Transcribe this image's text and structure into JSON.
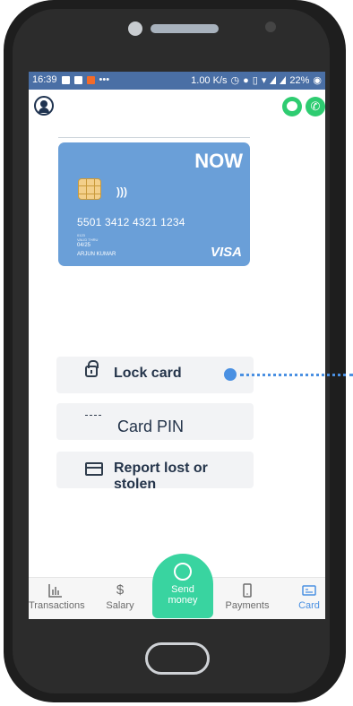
{
  "status_bar": {
    "time": "16:39",
    "speed": "1.00 K/s",
    "battery": "22%"
  },
  "card": {
    "brand": "NOW",
    "nfc_symbol": ")))",
    "number": "5501 3412 4321 1234",
    "valid_small": "0123",
    "valid_label": "VALID THRU",
    "expiry": "04/25",
    "holder": "ARJUN KUMAR",
    "network": "VISA"
  },
  "actions": {
    "lock": "Lock card",
    "pin": "Card PIN",
    "lost": "Report lost or stolen"
  },
  "nav": {
    "transactions": "Transactions",
    "salary": "Salary",
    "send_line1": "Send",
    "send_line2": "money",
    "payments": "Payments",
    "card": "Card"
  },
  "colors": {
    "status_bar": "#4a6fa5",
    "card": "#6a9fd8",
    "accent": "#4a90e2",
    "send_button": "#39d4a0",
    "call_chat": "#2ecc71"
  },
  "icons": {
    "profile": "profile-icon",
    "chat": "chat-icon",
    "call": "phone-icon",
    "lock": "lock-icon",
    "pin": "pin-icon",
    "lost": "card-icon"
  }
}
